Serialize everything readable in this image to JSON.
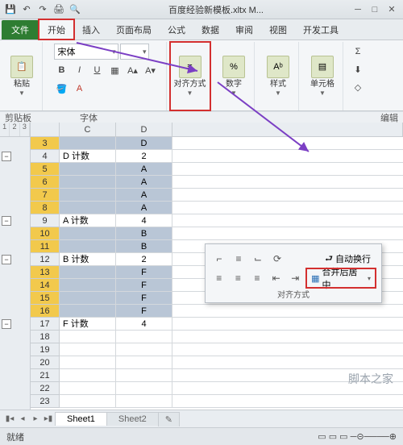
{
  "title": "百度经验新模板.xltx M...",
  "qat": [
    "save",
    "undo",
    "redo",
    "print",
    "preview",
    "sep",
    "paste",
    "sep",
    "formula",
    "sep",
    "sigma"
  ],
  "win": [
    "min",
    "max",
    "close"
  ],
  "tabs": {
    "file": "文件",
    "items": [
      "开始",
      "插入",
      "页面布局",
      "公式",
      "数据",
      "审阅",
      "视图",
      "开发工具"
    ],
    "active": 0
  },
  "ribbon": {
    "paste": {
      "label": "粘贴"
    },
    "font": {
      "name": "宋体",
      "size": "",
      "bold": "B",
      "italic": "I",
      "underline": "U",
      "label": "字体"
    },
    "align": {
      "label": "对齐方式"
    },
    "number": {
      "label": "数字"
    },
    "styles": {
      "label": "样式"
    },
    "cells": {
      "label": "单元格"
    },
    "editing": {
      "label": "编辑"
    },
    "clipboard": {
      "label": "剪贴板"
    }
  },
  "popup": {
    "wrap": "自动换行",
    "merge": "合并后居中",
    "label": "对齐方式"
  },
  "cols": [
    "C",
    "D"
  ],
  "rows": [
    {
      "n": 3,
      "sel": true,
      "c": "",
      "d": "D"
    },
    {
      "n": 4,
      "sel": false,
      "c": "D 计数",
      "d": "2",
      "grp": true
    },
    {
      "n": 5,
      "sel": true,
      "c": "",
      "d": "A"
    },
    {
      "n": 6,
      "sel": true,
      "c": "",
      "d": "A"
    },
    {
      "n": 7,
      "sel": true,
      "c": "",
      "d": "A"
    },
    {
      "n": 8,
      "sel": true,
      "c": "",
      "d": "A"
    },
    {
      "n": 9,
      "sel": false,
      "c": "A 计数",
      "d": "4",
      "grp": true
    },
    {
      "n": 10,
      "sel": true,
      "c": "",
      "d": "B"
    },
    {
      "n": 11,
      "sel": true,
      "c": "",
      "d": "B"
    },
    {
      "n": 12,
      "sel": false,
      "c": "B 计数",
      "d": "2",
      "grp": true
    },
    {
      "n": 13,
      "sel": true,
      "c": "",
      "d": "F"
    },
    {
      "n": 14,
      "sel": true,
      "c": "",
      "d": "F"
    },
    {
      "n": 15,
      "sel": true,
      "c": "",
      "d": "F"
    },
    {
      "n": 16,
      "sel": true,
      "c": "",
      "d": "F"
    },
    {
      "n": 17,
      "sel": false,
      "c": "F 计数",
      "d": "4",
      "grp": true
    },
    {
      "n": 18,
      "sel": false,
      "c": "",
      "d": ""
    },
    {
      "n": 19,
      "sel": false,
      "c": "",
      "d": ""
    },
    {
      "n": 20,
      "sel": false,
      "c": "",
      "d": ""
    },
    {
      "n": 21,
      "sel": false,
      "c": "",
      "d": ""
    },
    {
      "n": 22,
      "sel": false,
      "c": "",
      "d": ""
    },
    {
      "n": 23,
      "sel": false,
      "c": "",
      "d": ""
    }
  ],
  "sheets": {
    "items": [
      "Sheet1",
      "Sheet2"
    ],
    "active": 0
  },
  "status": {
    "left": "就绪"
  },
  "watermark": "脚本之家"
}
